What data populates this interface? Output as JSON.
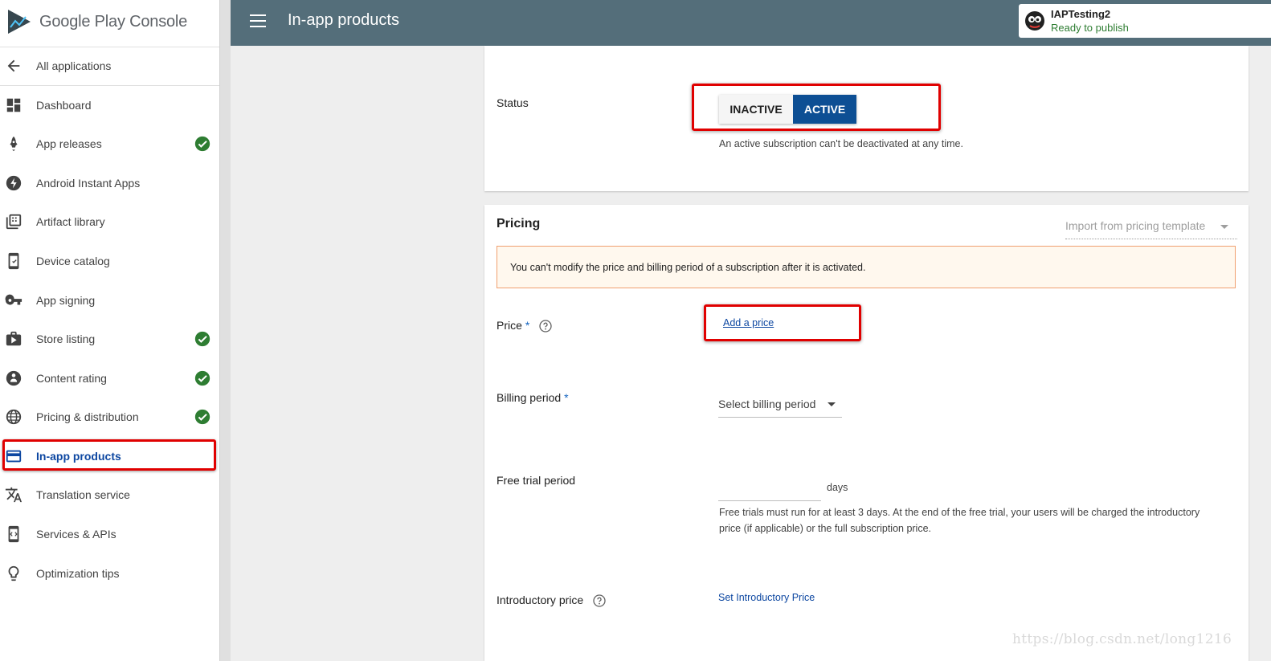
{
  "brand": {
    "logo_text": "Google Play Console"
  },
  "sidebar": {
    "back": {
      "label": "All applications"
    },
    "items": [
      {
        "label": "Dashboard",
        "icon": "dashboard-icon",
        "checked": false
      },
      {
        "label": "App releases",
        "icon": "rocket-icon",
        "checked": true
      },
      {
        "label": "Android Instant Apps",
        "icon": "bolt-icon",
        "checked": false
      },
      {
        "label": "Artifact library",
        "icon": "library-icon",
        "checked": false
      },
      {
        "label": "Device catalog",
        "icon": "device-icon",
        "checked": false
      },
      {
        "label": "App signing",
        "icon": "key-icon",
        "checked": false
      },
      {
        "label": "Store listing",
        "icon": "store-icon",
        "checked": true
      },
      {
        "label": "Content rating",
        "icon": "rating-icon",
        "checked": true
      },
      {
        "label": "Pricing & distribution",
        "icon": "globe-icon",
        "checked": true
      },
      {
        "label": "In-app products",
        "icon": "card-icon",
        "checked": false,
        "active": true
      },
      {
        "label": "Translation service",
        "icon": "translate-icon",
        "checked": false
      },
      {
        "label": "Services & APIs",
        "icon": "api-icon",
        "checked": false
      },
      {
        "label": "Optimization tips",
        "icon": "bulb-icon",
        "checked": false
      }
    ]
  },
  "header": {
    "title": "In-app products",
    "app_name": "IAPTesting2",
    "app_status": "Ready to publish"
  },
  "status_section": {
    "label": "Status",
    "inactive_label": "INACTIVE",
    "active_label": "ACTIVE",
    "selected": "ACTIVE",
    "helper": "An active subscription can't be deactivated at any time."
  },
  "pricing": {
    "title": "Pricing",
    "import_label": "Import from pricing template",
    "warning": "You can't modify the price and billing period of a subscription after it is activated.",
    "price_label": "Price",
    "price_required": "*",
    "add_price": "Add a price",
    "billing_label": "Billing period",
    "billing_required": "*",
    "billing_placeholder": "Select billing period",
    "trial_label": "Free trial period",
    "trial_value": "",
    "trial_unit": "days",
    "trial_helper_1": "Free trials must run for at least 3 days. At the end of the free trial, your users will be charged the introductory",
    "trial_helper_2": "price (if applicable) or the full subscription price.",
    "intro_label": "Introductory price",
    "intro_link": "Set Introductory Price"
  },
  "watermark": "https://blog.csdn.net/long1216",
  "colors": {
    "header": "#546e7a",
    "accent": "#0d4f94",
    "check": "#2e7d32",
    "highlight": "#e00000"
  }
}
